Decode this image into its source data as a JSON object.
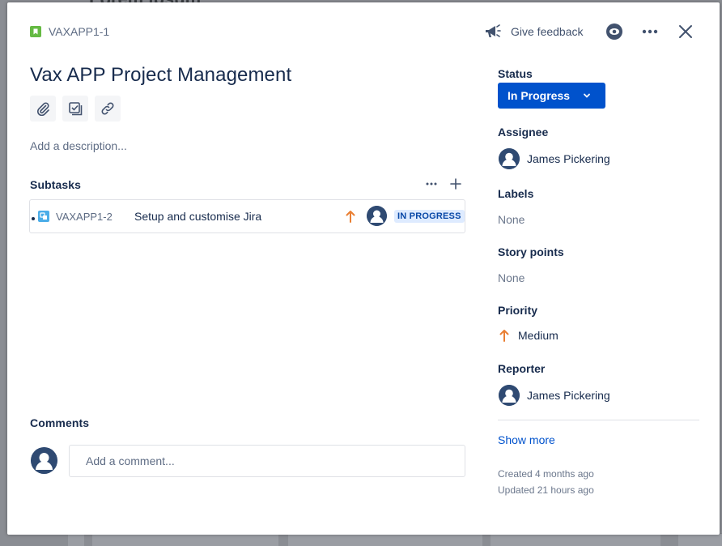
{
  "background": {
    "partial_text": "Lorem ipsum"
  },
  "header": {
    "issue_key": "VAXAPP1-1",
    "feedback_label": "Give feedback",
    "issue_type_color": "#65ba43"
  },
  "issue": {
    "title": "Vax APP Project Management",
    "description_placeholder": "Add a description..."
  },
  "subtasks": {
    "heading": "Subtasks",
    "items": [
      {
        "key": "VAXAPP1-2",
        "summary": "Setup and customise Jira",
        "status": "IN PROGRESS",
        "priority_color": "#e97f33"
      }
    ]
  },
  "comments": {
    "heading": "Comments",
    "placeholder": "Add a comment..."
  },
  "sidebar": {
    "status_label": "Status",
    "status_value": "In Progress",
    "assignee_label": "Assignee",
    "assignee_name": "James Pickering",
    "labels_label": "Labels",
    "labels_value": "None",
    "story_points_label": "Story points",
    "story_points_value": "None",
    "priority_label": "Priority",
    "priority_value": "Medium",
    "reporter_label": "Reporter",
    "reporter_name": "James Pickering",
    "show_more": "Show more",
    "created": "Created 4 months ago",
    "updated": "Updated 21 hours ago"
  },
  "colors": {
    "accent": "#0052cc",
    "lozenge_bg": "#deebff",
    "lozenge_text": "#0747a6",
    "priority_medium": "#e97f33"
  }
}
